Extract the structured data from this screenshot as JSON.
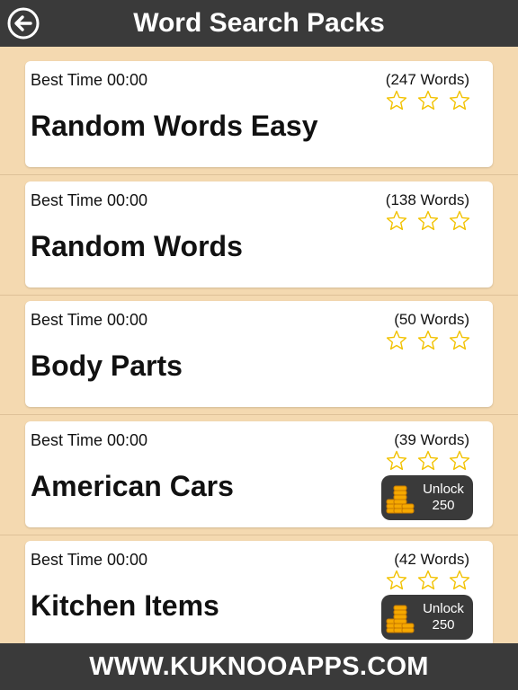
{
  "header": {
    "title": "Word Search Packs",
    "back_icon": "arrow-left-circle-icon"
  },
  "packs": [
    {
      "best_time": "Best Time 00:00",
      "word_count": "(247 Words)",
      "name": "Random Words Easy",
      "stars_earned": 0,
      "stars_total": 3,
      "locked": false
    },
    {
      "best_time": "Best Time 00:00",
      "word_count": "(138 Words)",
      "name": "Random Words",
      "stars_earned": 0,
      "stars_total": 3,
      "locked": false
    },
    {
      "best_time": "Best Time 00:00",
      "word_count": "(50 Words)",
      "name": "Body Parts",
      "stars_earned": 0,
      "stars_total": 3,
      "locked": false
    },
    {
      "best_time": "Best Time 00:00",
      "word_count": "(39 Words)",
      "name": "American Cars",
      "stars_earned": 0,
      "stars_total": 3,
      "locked": true,
      "unlock_label": "Unlock",
      "unlock_cost": "250"
    },
    {
      "best_time": "Best Time 00:00",
      "word_count": "(42 Words)",
      "name": "Kitchen Items",
      "stars_earned": 0,
      "stars_total": 3,
      "locked": true,
      "unlock_label": "Unlock",
      "unlock_cost": "250"
    }
  ],
  "footer": {
    "text": "WWW.KUKNOOAPPS.COM"
  },
  "colors": {
    "background": "#f4d9b0",
    "bar": "#3a3a3a",
    "star_outline": "#f2c200",
    "coin": "#f5a800"
  }
}
